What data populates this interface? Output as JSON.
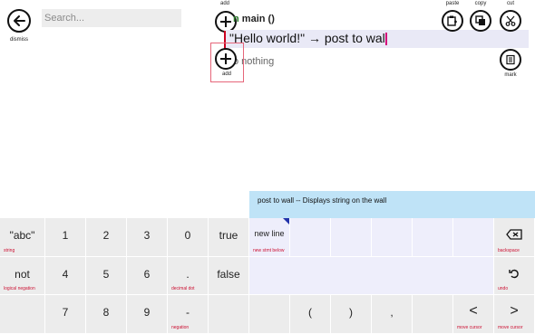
{
  "nav": {
    "dismiss_label": "dismiss"
  },
  "search": {
    "placeholder": "Search..."
  },
  "code": {
    "add_label": "add",
    "fn_keyword": "n",
    "fn_name": "main ()",
    "statement": "\"Hello world!\" → post to wall",
    "nothing_text": "o nothing"
  },
  "toolbar": {
    "paste": "paste",
    "copy": "copy",
    "cut": "cut",
    "mark": "mark"
  },
  "help": {
    "text": "post to wall -- Displays string on the wall"
  },
  "keyboard": {
    "row1": {
      "str": {
        "label": "\"abc\"",
        "sub": "string"
      },
      "k1": "1",
      "k2": "2",
      "k3": "3",
      "k0": "0",
      "true": "true",
      "newline": {
        "label": "new line",
        "sub": "new stmt below"
      },
      "backspace_sub": "backspace"
    },
    "row2": {
      "not": {
        "label": "not",
        "sub": "logical negation"
      },
      "k4": "4",
      "k5": "5",
      "k6": "6",
      "dot": {
        "label": ".",
        "sub": "decimal dot"
      },
      "false": "false",
      "undo_sub": "undo"
    },
    "row3": {
      "k7": "7",
      "k8": "8",
      "k9": "9",
      "neg": {
        "label": "-",
        "sub": "negation"
      },
      "lparen": "(",
      "rparen": ")",
      "comma": ",",
      "left": {
        "label": "<",
        "sub": "move cursor"
      },
      "right": {
        "label": ">",
        "sub": "move cursor"
      }
    }
  }
}
